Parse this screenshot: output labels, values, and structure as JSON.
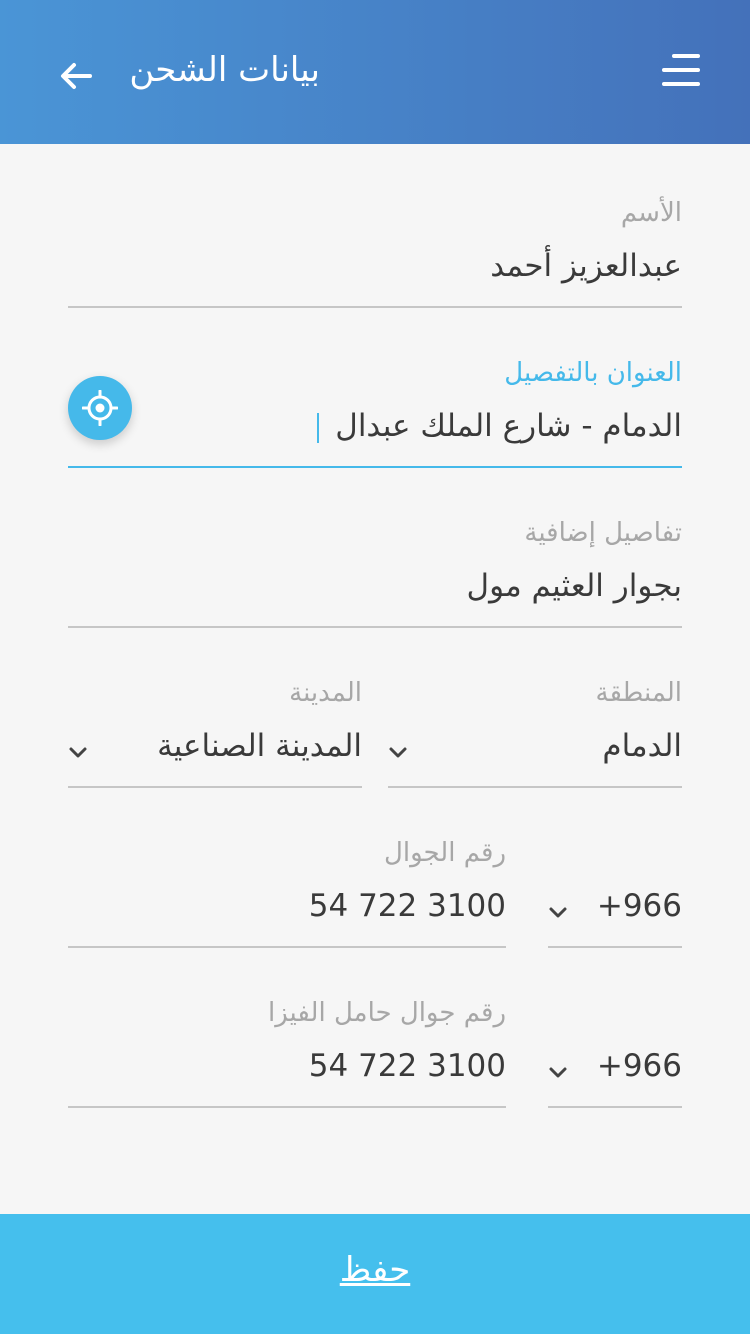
{
  "header": {
    "title": "بيانات الشحن",
    "back_icon": "arrow-left-icon",
    "menu_icon": "menu-icon"
  },
  "form": {
    "name": {
      "label": "الأسم",
      "value": "عبدالعزيز أحمد"
    },
    "address": {
      "label": "العنوان بالتفصيل",
      "value": "الدمام - شارع الملك عبدال",
      "locate_icon": "target-location-icon"
    },
    "extra": {
      "label": "تفاصيل إضافية",
      "value": "بجوار العثيم مول"
    },
    "region": {
      "label": "المنطقة",
      "value": "الدمام"
    },
    "city": {
      "label": "المدينة",
      "value": "المدينة الصناعية"
    },
    "mobile": {
      "label": "رقم الجوال",
      "code": "+966",
      "number": "54 722 3100"
    },
    "visa_mobile": {
      "label": "رقم جوال حامل الفيزا",
      "code": "+966",
      "number": "54 722 3100"
    }
  },
  "actions": {
    "save_label": "حفظ"
  },
  "colors": {
    "accent": "#45b9ea",
    "header_start": "#4a95d6",
    "header_end": "#4471ba",
    "save_bar": "#45bfed"
  }
}
